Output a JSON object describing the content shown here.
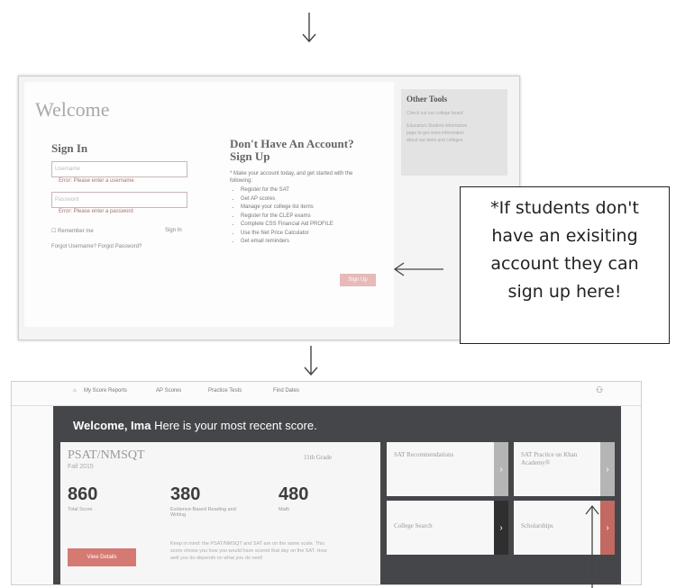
{
  "signin_page": {
    "welcome_title": "Welcome",
    "signin_heading": "Sign In",
    "username_placeholder": "Username",
    "username_error": "Error: Please enter a username",
    "password_placeholder": "Password",
    "password_error": "Error: Please enter a password",
    "remember_me": "Remember me",
    "signin_button": "Sign In",
    "forgot_links": "Forgot Username? Forgot Password?",
    "signup_heading": "Don't Have An Account? Sign Up",
    "signup_intro": "* Make your account today, and get started with the following:",
    "signup_items": [
      "Register for the SAT",
      "Get AP scores",
      "Manage your college list items",
      "Register for the CLEP exams",
      "Complete CSS Financial Aid PROFILE",
      "Use the Net Price Calculator",
      "Get email reminders"
    ],
    "signup_button": "Sign Up",
    "other_tools": {
      "heading": "Other Tools",
      "line1": "Check out our college board",
      "line2": "Educators Student information",
      "line3": "page to get more information",
      "line4": "about our tests and colleges"
    }
  },
  "callout": {
    "lines": [
      "*If students don't",
      "have an exisiting",
      "account they can",
      "sign up here!"
    ]
  },
  "score_page": {
    "nav": [
      "My Score Reports",
      "AP Scores",
      "Practice Tests",
      "Find Dates"
    ],
    "welcome_prefix": "Welcome, Ima",
    "welcome_suffix": "Here is your most recent score.",
    "test_name": "PSAT/NMSQT",
    "test_date": "Fall 2015",
    "grade": "11th Grade",
    "total_score": "860",
    "total_label": "Total Score",
    "ebrw_score": "380",
    "ebrw_label": "Evidence-Based Reading and Writing",
    "math_score": "480",
    "math_label": "Math",
    "view_details": "View Details",
    "note": "Keep in mind: the PSAT/NMSQT and SAT are on the same scale. This score shows you how you would have scored that day on the SAT. How well you do depends on what you do next!",
    "tiles": {
      "sat_recs": "SAT Recommendations",
      "sat_practice": "SAT Practice on Khan Academy®",
      "college_search": "College Search",
      "scholarships": "Scholarships"
    },
    "colors": {
      "dark_bg": "#444649",
      "btn": "#d57a72",
      "chev_gray": "#b5b5b5",
      "chev_red": "#c26a62",
      "chev_dark": "#2f2f2f"
    }
  }
}
